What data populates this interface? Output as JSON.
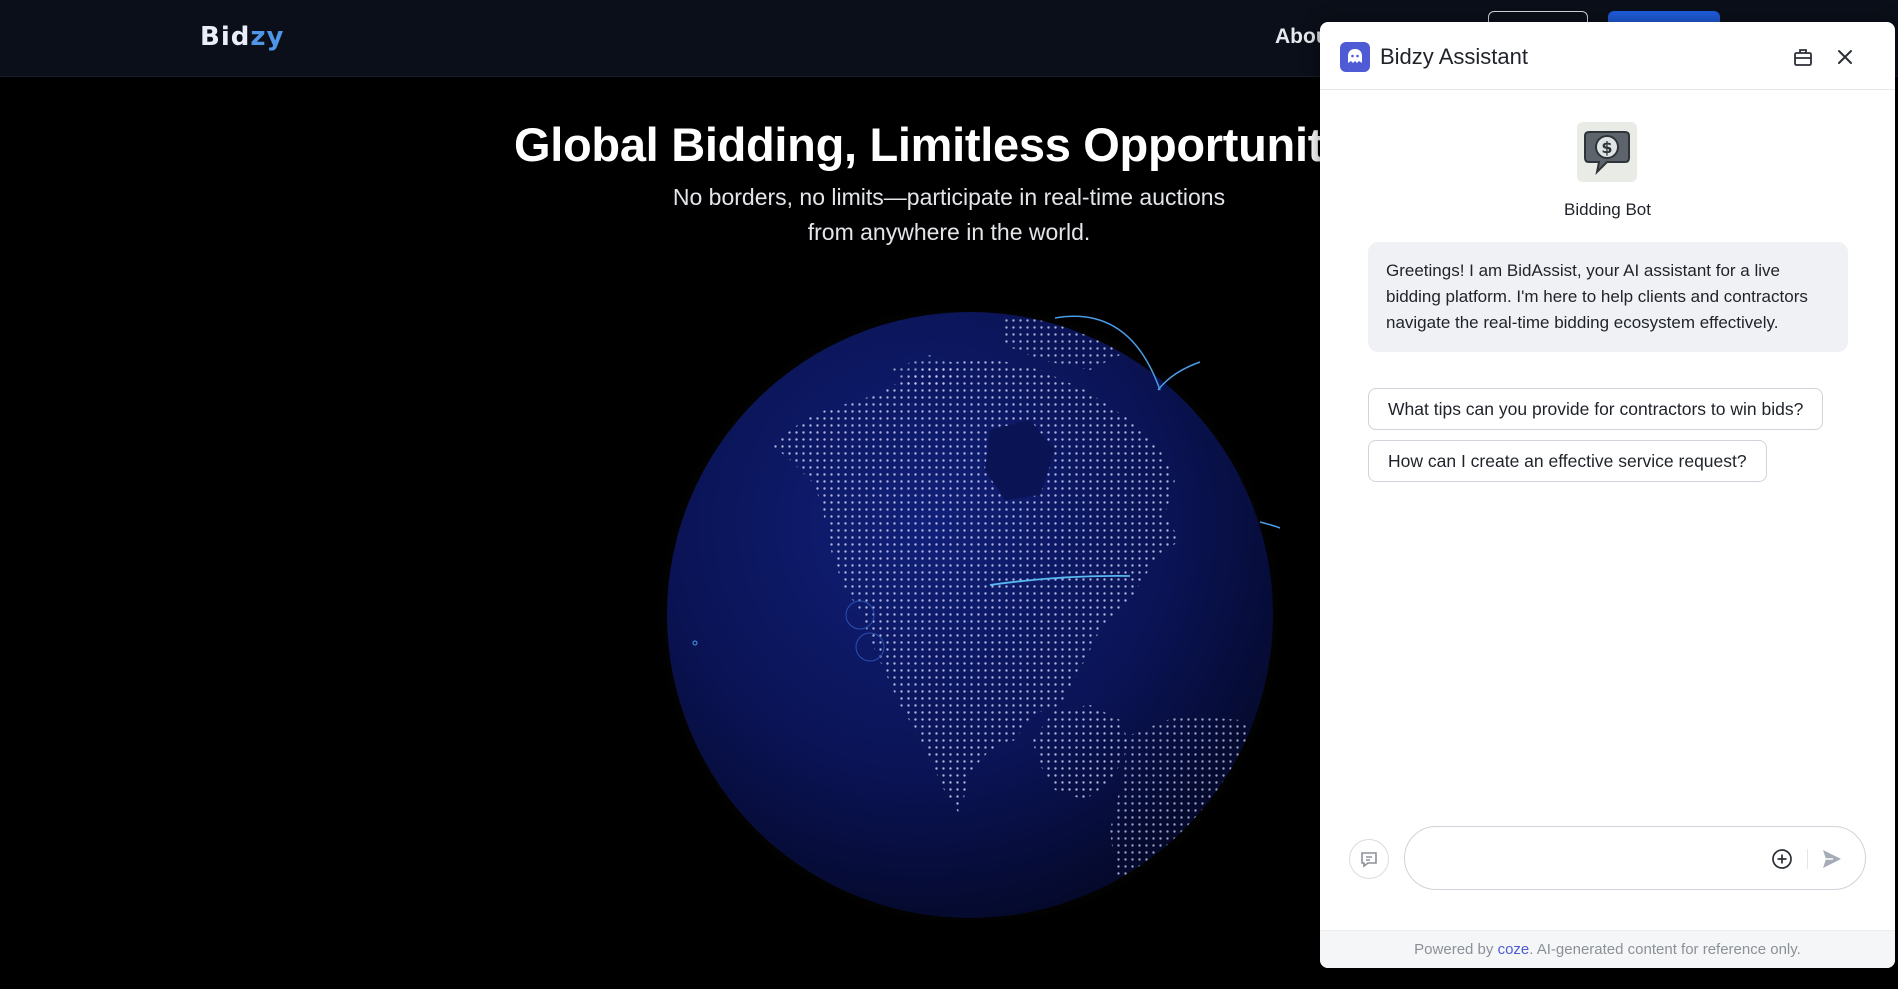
{
  "header": {
    "logo_main": "Bid",
    "logo_accent": "zy",
    "nav_about": "About"
  },
  "hero": {
    "title": "Global Bidding, Limitless Opportunities",
    "subtitle": "No borders, no limits—participate in real-time auctions from anywhere in the world."
  },
  "chat": {
    "title": "Bidzy Assistant",
    "bot_name": "Bidding Bot",
    "greeting": "Greetings! I am BidAssist, your AI assistant for a live bidding platform. I'm here to help clients and contractors navigate the real-time bidding ecosystem effectively.",
    "suggestions": [
      "What tips can you provide for contractors to win bids?",
      "How can I create an effective service request?"
    ],
    "input": {
      "value": "",
      "placeholder": ""
    },
    "footer": {
      "prefix": "Powered by ",
      "brand": "coze",
      "suffix": ". AI-generated content for reference only."
    }
  },
  "icons": {
    "bot_logo": "bot-logo-icon",
    "bag": "briefcase-icon",
    "close": "close-icon",
    "new_topic": "new-topic-icon",
    "attach": "plus-circle-icon",
    "send": "send-icon"
  },
  "colors": {
    "page_bg": "#000000",
    "header_bg": "#0b0f19",
    "accent_blue": "#1f5ee0",
    "logo_accent": "#4f95e8",
    "coze_brand": "#4f5bd5",
    "globe": "#0a1250"
  }
}
